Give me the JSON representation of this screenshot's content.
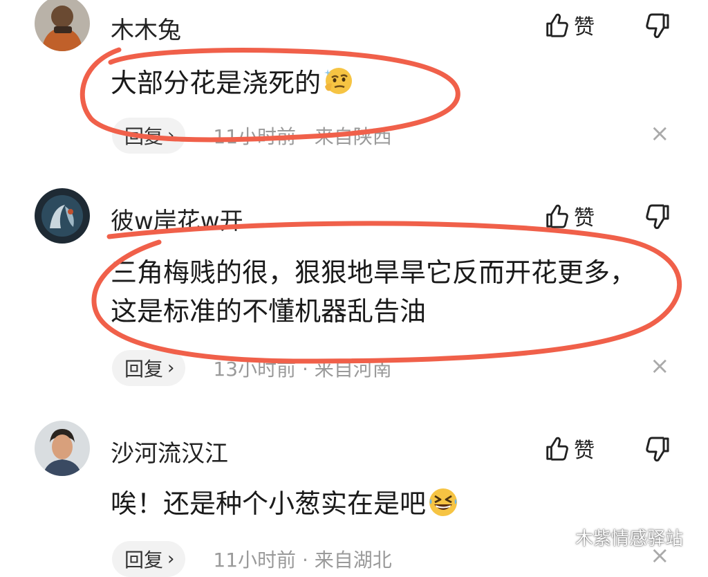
{
  "comments": [
    {
      "username": "木木兔",
      "like_label": "赞",
      "text_lines": [
        "大部分花是浇死的"
      ],
      "emoji": "thinking-face",
      "reply_label": "回复",
      "time": "11小时前",
      "location": "来自陕西"
    },
    {
      "username": "彼w岸花w开",
      "like_label": "赞",
      "text_lines": [
        "三角梅贱的很，狠狠地旱旱它反而开花更多，",
        "这是标准的不懂机器乱告油"
      ],
      "reply_label": "回复",
      "time": "13小时前",
      "location": "来自河南"
    },
    {
      "username": "沙河流汉江",
      "like_label": "赞",
      "text_lines": [
        "唉！还是种个小葱实在是吧"
      ],
      "emoji": "grinning-squint-face",
      "reply_label": "回复",
      "time": "11小时前",
      "location": "来自湖北"
    }
  ],
  "meta_separator": "·",
  "close_glyph": "×",
  "reply_chevron": "›",
  "watermark": {
    "text": "木紫情感驿站",
    "icon": "wechat-icon"
  },
  "colors": {
    "annotation": "#f0604a",
    "meta": "#9a9a9a",
    "reply_bg": "#f2f2f2"
  }
}
